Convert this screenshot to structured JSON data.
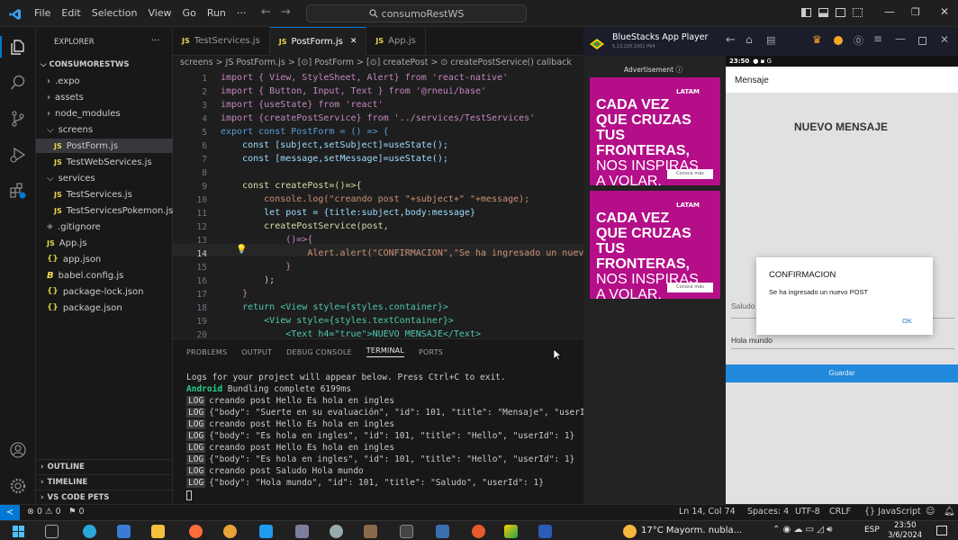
{
  "titlebar": {
    "menu": [
      "File",
      "Edit",
      "Selection",
      "View",
      "Go",
      "Run",
      "···"
    ],
    "search": "consumoRestWS"
  },
  "explorer": {
    "header": "EXPLORER",
    "more": "···",
    "project": "CONSUMORESTWS",
    "items": [
      {
        "label": ".expo",
        "type": "folder"
      },
      {
        "label": "assets",
        "type": "folder"
      },
      {
        "label": "node_modules",
        "type": "folder"
      },
      {
        "label": "screens",
        "type": "folder-open"
      },
      {
        "label": "PostForm.js",
        "type": "js"
      },
      {
        "label": "TestWebServices.js",
        "type": "js"
      },
      {
        "label": "services",
        "type": "folder-open"
      },
      {
        "label": "TestServices.js",
        "type": "js"
      },
      {
        "label": "TestServicesPokemon.js",
        "type": "js"
      },
      {
        "label": ".gitignore",
        "type": "git"
      },
      {
        "label": "App.js",
        "type": "js"
      },
      {
        "label": "app.json",
        "type": "json"
      },
      {
        "label": "babel.config.js",
        "type": "babel"
      },
      {
        "label": "package-lock.json",
        "type": "json"
      },
      {
        "label": "package.json",
        "type": "json"
      }
    ],
    "outline": "OUTLINE",
    "timeline": "TIMELINE",
    "vscode_pets": "VS CODE PETS"
  },
  "editor": {
    "tabs": [
      {
        "label": "TestServices.js",
        "active": false
      },
      {
        "label": "PostForm.js",
        "active": true
      },
      {
        "label": "App.js",
        "active": false
      }
    ],
    "js_badge": "JS",
    "close_glyph": "✕",
    "breadcrumb": "screens > JS PostForm.js > [⊙] PostForm > [⊙] createPost > ⊙ createPostService() callback",
    "line_numbers": [
      "1",
      "2",
      "3",
      "4",
      "5",
      "6",
      "7",
      "8",
      "9",
      "10",
      "11",
      "12",
      "13",
      "14",
      "15",
      "16",
      "17",
      "18",
      "19",
      "20"
    ],
    "code": [
      "import { View, StyleSheet, Alert} from 'react-native'",
      "import { Button, Input, Text } from '@rneui/base'",
      "import {useState} from 'react'",
      "import {createPostService} from '../services/TestServices'",
      "export const PostForm = () => {",
      "    const [subject,setSubject]=useState();",
      "    const [message,setMessage]=useState();",
      "",
      "    const createPost=()=>{",
      "        console.log(\"creando post \"+subject+\" \"+message);",
      "        let post = {title:subject,body:message}",
      "        createPostService(post,",
      "            ()=>{",
      "                Alert.alert(\"CONFIRMACION\",\"Se ha ingresado un nuev",
      "            }",
      "        );",
      "    }",
      "    return <View style={styles.container}>",
      "        <View style={styles.textContainer}>",
      "            <Text h4=\"true\">NUEVO MENSAJE</Text>"
    ]
  },
  "panel": {
    "tabs": [
      "PROBLEMS",
      "OUTPUT",
      "DEBUG CONSOLE",
      "TERMINAL",
      "PORTS"
    ],
    "active_tab": "TERMINAL",
    "log_badge": "LOG",
    "intro": "Logs for your project will appear below. Press Ctrl+C to exit.",
    "bundling_android": "Android",
    "bundling_rest": " Bundling complete 6199ms",
    "logs": [
      "creando post Hello Es hola en ingles",
      "{\"body\": \"Suerte en su evaluación\", \"id\": 101, \"title\": \"Mensaje\", \"userId\"",
      "creando post Hello Es hola en ingles",
      "{\"body\": \"Es hola en ingles\", \"id\": 101, \"title\": \"Hello\", \"userId\": 1}",
      "creando post Hello Es hola en ingles",
      "{\"body\": \"Es hola en ingles\", \"id\": 101, \"title\": \"Hello\", \"userId\": 1}",
      "creando post Saludo Hola mundo",
      "{\"body\": \"Hola mundo\", \"id\": 101, \"title\": \"Saludo\", \"userId\": 1}"
    ]
  },
  "statusbar": {
    "problems": "⊗ 0 ⚠ 0",
    "ports": "⚑ 0",
    "position": "Ln 14, Col 74",
    "spaces": "Spaces: 4",
    "encoding": "UTF-8",
    "eol": "CRLF",
    "language": "{} JavaScript"
  },
  "bluestacks": {
    "title": "BlueStacks App Player",
    "version": "5.13.220.1001 P64",
    "advert_label": "Advertisement ⓘ",
    "ads": [
      {
        "line1": "CADA VEZ",
        "line2": "QUE CRUZAS",
        "line3": "TUS FRONTERAS,",
        "line4": "NOS INSPIRAS",
        "line5": "A VOLAR.",
        "cta": "Conoce más",
        "brand": "LATAM"
      },
      {
        "line1": "CADA VEZ",
        "line2": "QUE CRUZAS",
        "line3": "TUS FRONTERAS,",
        "line4": "NOS INSPIRAS",
        "line5": "A VOLAR.",
        "cta": "Conoce más",
        "brand": "LATAM"
      }
    ],
    "phone_time": "23:50",
    "app_header": "Mensaje",
    "app_title": "NUEVO MENSAJE",
    "subject_label": "Saludo",
    "message_value": "Hola mundo",
    "save_button": "Guardar",
    "dialog": {
      "title": "CONFIRMACION",
      "message": "Se ha ingresado un nuevo POST",
      "ok": "OK"
    }
  },
  "taskbar": {
    "weather": "17°C  Mayorm. nubla...",
    "lang": "ESP",
    "time": "23:50",
    "date": "3/6/2024"
  },
  "colors": {
    "accent": "#0078d4",
    "ad_magenta": "#b40e88",
    "bs_accent": "#5c8ef2"
  }
}
